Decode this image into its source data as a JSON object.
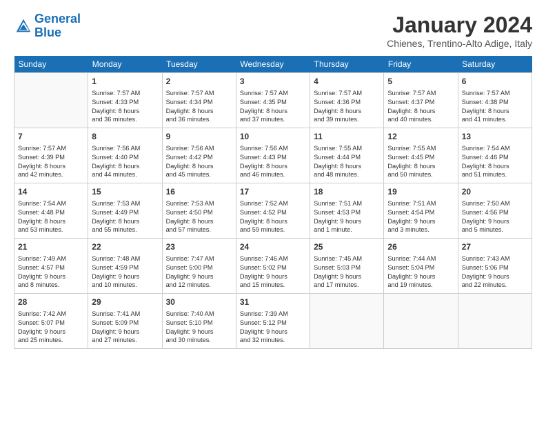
{
  "header": {
    "logo_line1": "General",
    "logo_line2": "Blue",
    "month": "January 2024",
    "location": "Chienes, Trentino-Alto Adige, Italy"
  },
  "weekdays": [
    "Sunday",
    "Monday",
    "Tuesday",
    "Wednesday",
    "Thursday",
    "Friday",
    "Saturday"
  ],
  "weeks": [
    [
      {
        "day": "",
        "info": ""
      },
      {
        "day": "1",
        "info": "Sunrise: 7:57 AM\nSunset: 4:33 PM\nDaylight: 8 hours\nand 36 minutes."
      },
      {
        "day": "2",
        "info": "Sunrise: 7:57 AM\nSunset: 4:34 PM\nDaylight: 8 hours\nand 36 minutes."
      },
      {
        "day": "3",
        "info": "Sunrise: 7:57 AM\nSunset: 4:35 PM\nDaylight: 8 hours\nand 37 minutes."
      },
      {
        "day": "4",
        "info": "Sunrise: 7:57 AM\nSunset: 4:36 PM\nDaylight: 8 hours\nand 39 minutes."
      },
      {
        "day": "5",
        "info": "Sunrise: 7:57 AM\nSunset: 4:37 PM\nDaylight: 8 hours\nand 40 minutes."
      },
      {
        "day": "6",
        "info": "Sunrise: 7:57 AM\nSunset: 4:38 PM\nDaylight: 8 hours\nand 41 minutes."
      }
    ],
    [
      {
        "day": "7",
        "info": "Sunrise: 7:57 AM\nSunset: 4:39 PM\nDaylight: 8 hours\nand 42 minutes."
      },
      {
        "day": "8",
        "info": "Sunrise: 7:56 AM\nSunset: 4:40 PM\nDaylight: 8 hours\nand 44 minutes."
      },
      {
        "day": "9",
        "info": "Sunrise: 7:56 AM\nSunset: 4:42 PM\nDaylight: 8 hours\nand 45 minutes."
      },
      {
        "day": "10",
        "info": "Sunrise: 7:56 AM\nSunset: 4:43 PM\nDaylight: 8 hours\nand 46 minutes."
      },
      {
        "day": "11",
        "info": "Sunrise: 7:55 AM\nSunset: 4:44 PM\nDaylight: 8 hours\nand 48 minutes."
      },
      {
        "day": "12",
        "info": "Sunrise: 7:55 AM\nSunset: 4:45 PM\nDaylight: 8 hours\nand 50 minutes."
      },
      {
        "day": "13",
        "info": "Sunrise: 7:54 AM\nSunset: 4:46 PM\nDaylight: 8 hours\nand 51 minutes."
      }
    ],
    [
      {
        "day": "14",
        "info": "Sunrise: 7:54 AM\nSunset: 4:48 PM\nDaylight: 8 hours\nand 53 minutes."
      },
      {
        "day": "15",
        "info": "Sunrise: 7:53 AM\nSunset: 4:49 PM\nDaylight: 8 hours\nand 55 minutes."
      },
      {
        "day": "16",
        "info": "Sunrise: 7:53 AM\nSunset: 4:50 PM\nDaylight: 8 hours\nand 57 minutes."
      },
      {
        "day": "17",
        "info": "Sunrise: 7:52 AM\nSunset: 4:52 PM\nDaylight: 8 hours\nand 59 minutes."
      },
      {
        "day": "18",
        "info": "Sunrise: 7:51 AM\nSunset: 4:53 PM\nDaylight: 9 hours\nand 1 minute."
      },
      {
        "day": "19",
        "info": "Sunrise: 7:51 AM\nSunset: 4:54 PM\nDaylight: 9 hours\nand 3 minutes."
      },
      {
        "day": "20",
        "info": "Sunrise: 7:50 AM\nSunset: 4:56 PM\nDaylight: 9 hours\nand 5 minutes."
      }
    ],
    [
      {
        "day": "21",
        "info": "Sunrise: 7:49 AM\nSunset: 4:57 PM\nDaylight: 9 hours\nand 8 minutes."
      },
      {
        "day": "22",
        "info": "Sunrise: 7:48 AM\nSunset: 4:59 PM\nDaylight: 9 hours\nand 10 minutes."
      },
      {
        "day": "23",
        "info": "Sunrise: 7:47 AM\nSunset: 5:00 PM\nDaylight: 9 hours\nand 12 minutes."
      },
      {
        "day": "24",
        "info": "Sunrise: 7:46 AM\nSunset: 5:02 PM\nDaylight: 9 hours\nand 15 minutes."
      },
      {
        "day": "25",
        "info": "Sunrise: 7:45 AM\nSunset: 5:03 PM\nDaylight: 9 hours\nand 17 minutes."
      },
      {
        "day": "26",
        "info": "Sunrise: 7:44 AM\nSunset: 5:04 PM\nDaylight: 9 hours\nand 19 minutes."
      },
      {
        "day": "27",
        "info": "Sunrise: 7:43 AM\nSunset: 5:06 PM\nDaylight: 9 hours\nand 22 minutes."
      }
    ],
    [
      {
        "day": "28",
        "info": "Sunrise: 7:42 AM\nSunset: 5:07 PM\nDaylight: 9 hours\nand 25 minutes."
      },
      {
        "day": "29",
        "info": "Sunrise: 7:41 AM\nSunset: 5:09 PM\nDaylight: 9 hours\nand 27 minutes."
      },
      {
        "day": "30",
        "info": "Sunrise: 7:40 AM\nSunset: 5:10 PM\nDaylight: 9 hours\nand 30 minutes."
      },
      {
        "day": "31",
        "info": "Sunrise: 7:39 AM\nSunset: 5:12 PM\nDaylight: 9 hours\nand 32 minutes."
      },
      {
        "day": "",
        "info": ""
      },
      {
        "day": "",
        "info": ""
      },
      {
        "day": "",
        "info": ""
      }
    ]
  ]
}
